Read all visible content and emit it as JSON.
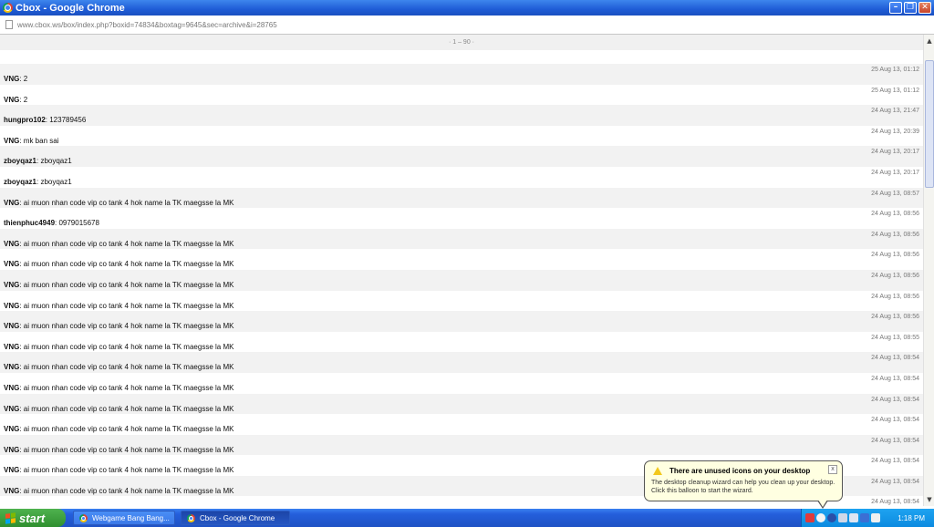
{
  "window": {
    "title": "Cbox - Google Chrome",
    "controls": {
      "minimize": "–",
      "maximize": "❐",
      "close": "✕"
    }
  },
  "address": {
    "url": "www.cbox.ws/box/index.php?boxid=74834&boxtag=9645&sec=archive&i=28765"
  },
  "pager": {
    "text": "· 1 – 90 ·"
  },
  "messages": [
    {
      "name": "VNG",
      "text": ": 2",
      "time": "25 Aug 13, 01:12"
    },
    {
      "name": "VNG",
      "text": ": 2",
      "time": "25 Aug 13, 01:12"
    },
    {
      "name": "hungpro102",
      "text": ": 123789456",
      "time": "24 Aug 13, 21:47"
    },
    {
      "name": "VNG",
      "text": ": mk ban sai",
      "time": "24 Aug 13, 20:39"
    },
    {
      "name": "zboyqaz1",
      "text": ": zboyqaz1",
      "time": "24 Aug 13, 20:17"
    },
    {
      "name": "zboyqaz1",
      "text": ": zboyqaz1",
      "time": "24 Aug 13, 20:17"
    },
    {
      "name": "VNG",
      "text": ": ai muon nhan code vip co tank 4 hok name la TK maegsse la MK",
      "time": "24 Aug 13, 08:57"
    },
    {
      "name": "thienphuc4949",
      "text": ": 0979015678",
      "time": "24 Aug 13, 08:56"
    },
    {
      "name": "VNG",
      "text": ": ai muon nhan code vip co tank 4 hok name la TK maegsse la MK",
      "time": "24 Aug 13, 08:56"
    },
    {
      "name": "VNG",
      "text": ": ai muon nhan code vip co tank 4 hok name la TK maegsse la MK",
      "time": "24 Aug 13, 08:56"
    },
    {
      "name": "VNG",
      "text": ": ai muon nhan code vip co tank 4 hok name la TK maegsse la MK",
      "time": "24 Aug 13, 08:56"
    },
    {
      "name": "VNG",
      "text": ": ai muon nhan code vip co tank 4 hok name la TK maegsse la MK",
      "time": "24 Aug 13, 08:56"
    },
    {
      "name": "VNG",
      "text": ": ai muon nhan code vip co tank 4 hok name la TK maegsse la MK",
      "time": "24 Aug 13, 08:56"
    },
    {
      "name": "VNG",
      "text": ": ai muon nhan code vip co tank 4 hok name la TK maegsse la MK",
      "time": "24 Aug 13, 08:55"
    },
    {
      "name": "VNG",
      "text": ": ai muon nhan code vip co tank 4 hok name la TK maegsse la MK",
      "time": "24 Aug 13, 08:54"
    },
    {
      "name": "VNG",
      "text": ": ai muon nhan code vip co tank 4 hok name la TK maegsse la MK",
      "time": "24 Aug 13, 08:54"
    },
    {
      "name": "VNG",
      "text": ": ai muon nhan code vip co tank 4 hok name la TK maegsse la MK",
      "time": "24 Aug 13, 08:54"
    },
    {
      "name": "VNG",
      "text": ": ai muon nhan code vip co tank 4 hok name la TK maegsse la MK",
      "time": "24 Aug 13, 08:54"
    },
    {
      "name": "VNG",
      "text": ": ai muon nhan code vip co tank 4 hok name la TK maegsse la MK",
      "time": "24 Aug 13, 08:54"
    },
    {
      "name": "VNG",
      "text": ": ai muon nhan code vip co tank 4 hok name la TK maegsse la MK",
      "time": "24 Aug 13, 08:54"
    },
    {
      "name": "VNG",
      "text": ": ai muon nhan code vip co tank 4 hok name la TK maegsse la MK",
      "time": "24 Aug 13, 08:54"
    },
    {
      "name": "",
      "text": "",
      "time": "24 Aug 13, 08:54"
    }
  ],
  "scrollbar": {
    "up": "▲",
    "down": "▼"
  },
  "taskbar": {
    "start_label": "start",
    "tasks": [
      {
        "label": "Webgame Bang Bang..."
      },
      {
        "label": "Cbox - Google Chrome"
      }
    ],
    "tray_icons": [
      "antivirus-icon",
      "network-icon",
      "shield-icon",
      "volume-icon",
      "monitor-icon",
      "messenger-icon",
      "display-icon"
    ],
    "clock": "1:18 PM"
  },
  "balloon": {
    "title": "There are unused icons on your desktop",
    "body": "The desktop cleanup wizard can help you clean up your desktop. Click this balloon to start the wizard.",
    "close": "x"
  },
  "colors": {
    "titlebar": "#1f5cd6",
    "taskbar": "#245edb",
    "start": "#3d9b3d",
    "tray": "#0c8ae0",
    "balloon": "#ffffe1"
  }
}
